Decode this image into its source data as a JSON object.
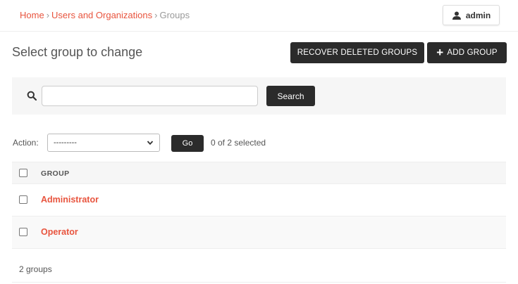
{
  "breadcrumb": {
    "home": "Home",
    "users_orgs": "Users and Organizations",
    "separator": "›",
    "current": "Groups"
  },
  "user_menu": {
    "label": "admin",
    "icon": "user-icon"
  },
  "page": {
    "title": "Select group to change"
  },
  "buttons": {
    "recover": "RECOVER DELETED GROUPS",
    "add": "ADD GROUP",
    "add_icon": "+",
    "search": "Search",
    "go": "Go"
  },
  "search": {
    "value": "",
    "placeholder": ""
  },
  "actions": {
    "label": "Action:",
    "selected_option": "---------",
    "selected_count": "0 of 2 selected"
  },
  "table": {
    "header": "GROUP",
    "rows": [
      {
        "name": "Administrator"
      },
      {
        "name": "Operator"
      }
    ]
  },
  "footer": {
    "count_text": "2 groups"
  },
  "colors": {
    "accent": "#e8543e",
    "button_dark": "#2b2b2b",
    "bar_bg": "#f6f6f6"
  }
}
